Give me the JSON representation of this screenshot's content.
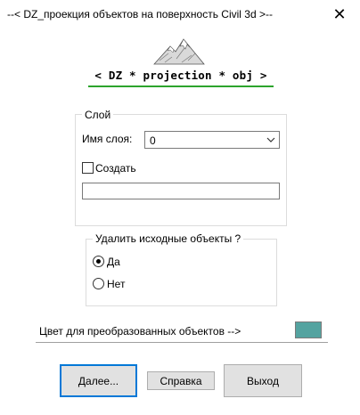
{
  "window": {
    "title": "--< DZ_проекция объектов на поверхность Civil 3d >--",
    "close_glyph": "✕"
  },
  "brand": {
    "logo_icon": "mountain-icon",
    "text": "< DZ * projection * obj >",
    "underline_color": "#2ca42c"
  },
  "layer_group": {
    "legend": "Слой",
    "layer_name_label": "Имя слоя:",
    "layer_select_value": "0",
    "create_label": "Создать",
    "create_checked": false,
    "new_layer_value": ""
  },
  "delete_group": {
    "legend": "Удалить исходные объекты ?",
    "options": [
      {
        "label": "Да",
        "selected": true
      },
      {
        "label": "Нет",
        "selected": false
      }
    ]
  },
  "color_row": {
    "label": "Цвет для преобразованных объектов  -->",
    "color": "#54a3a0"
  },
  "buttons": {
    "next": "Далее...",
    "help": "Справка",
    "exit": "Выход"
  }
}
